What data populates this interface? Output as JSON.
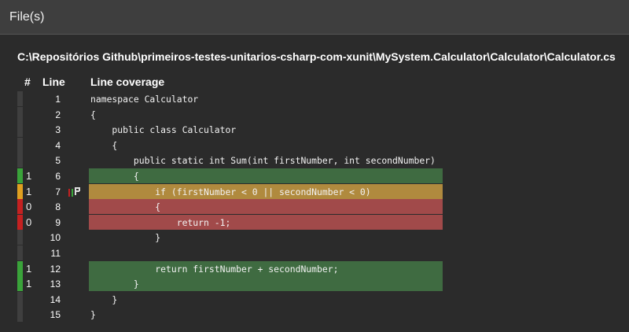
{
  "panel": {
    "title": "File(s)"
  },
  "file_path": "C:\\Repositórios Github\\primeiros-testes-unitarios-csharp-com-xunit\\MySystem.Calculator\\Calculator\\Calculator.cs",
  "columns": {
    "hits": "#",
    "line": "Line",
    "coverage": "Line coverage"
  },
  "colors": {
    "covered_bar": "#3aa33a",
    "partial_bar": "#e0a020",
    "uncovered_bar": "#c42121",
    "covered_bg": "#3f6b41",
    "partial_bg": "#b08a3e",
    "uncovered_bg": "#a14a4a"
  },
  "lines": [
    {
      "hits": "",
      "line": "1",
      "code": "namespace Calculator",
      "status": "none",
      "branch": false
    },
    {
      "hits": "",
      "line": "2",
      "code": "{",
      "status": "none",
      "branch": false
    },
    {
      "hits": "",
      "line": "3",
      "code": "    public class Calculator",
      "status": "none",
      "branch": false
    },
    {
      "hits": "",
      "line": "4",
      "code": "    {",
      "status": "none",
      "branch": false
    },
    {
      "hits": "",
      "line": "5",
      "code": "        public static int Sum(int firstNumber, int secondNumber)",
      "status": "none",
      "branch": false
    },
    {
      "hits": "1",
      "line": "6",
      "code": "        {",
      "status": "covered",
      "branch": false
    },
    {
      "hits": "1",
      "line": "7",
      "code": "            if (firstNumber < 0 || secondNumber < 0)",
      "status": "partial",
      "branch": true
    },
    {
      "hits": "0",
      "line": "8",
      "code": "            {",
      "status": "uncovered",
      "branch": false
    },
    {
      "hits": "0",
      "line": "9",
      "code": "                return -1;",
      "status": "uncovered",
      "branch": false
    },
    {
      "hits": "",
      "line": "10",
      "code": "            }",
      "status": "none",
      "branch": false
    },
    {
      "hits": "",
      "line": "11",
      "code": "",
      "status": "none",
      "branch": false
    },
    {
      "hits": "1",
      "line": "12",
      "code": "            return firstNumber + secondNumber;",
      "status": "covered",
      "branch": false
    },
    {
      "hits": "1",
      "line": "13",
      "code": "        }",
      "status": "covered",
      "branch": false
    },
    {
      "hits": "",
      "line": "14",
      "code": "    }",
      "status": "none",
      "branch": false
    },
    {
      "hits": "",
      "line": "15",
      "code": "}",
      "status": "none",
      "branch": false
    }
  ]
}
